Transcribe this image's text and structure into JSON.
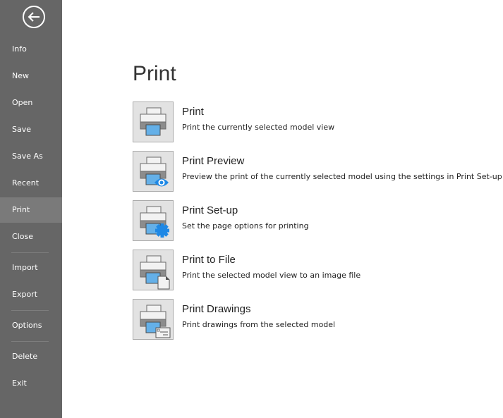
{
  "sidebar": {
    "back_icon": "back-arrow-circle-icon",
    "items": [
      {
        "label": "Info"
      },
      {
        "label": "New"
      },
      {
        "label": "Open"
      },
      {
        "label": "Save"
      },
      {
        "label": "Save As"
      },
      {
        "label": "Recent"
      },
      {
        "label": "Print",
        "active": true
      },
      {
        "label": "Close"
      },
      {
        "label": "Import"
      },
      {
        "label": "Export"
      },
      {
        "label": "Options"
      },
      {
        "label": "Delete"
      },
      {
        "label": "Exit"
      }
    ]
  },
  "main": {
    "title": "Print",
    "options": [
      {
        "title": "Print",
        "description": "Print the currently selected model view",
        "icon": "printer-icon"
      },
      {
        "title": "Print Preview",
        "description": "Preview the print of the currently selected model using the settings in Print Set-up",
        "icon": "printer-eye-icon"
      },
      {
        "title": "Print Set-up",
        "description": "Set the page options for printing",
        "icon": "printer-gear-icon"
      },
      {
        "title": "Print to File",
        "description": "Print the selected model view to an image file",
        "icon": "printer-file-icon"
      },
      {
        "title": "Print Drawings",
        "description": "Print drawings from the selected model",
        "icon": "printer-drawing-icon"
      }
    ]
  },
  "colors": {
    "sidebar": "#666666",
    "active": "#7a7a7a",
    "accent": "#1e88e5",
    "screen": "#64b0e8"
  }
}
